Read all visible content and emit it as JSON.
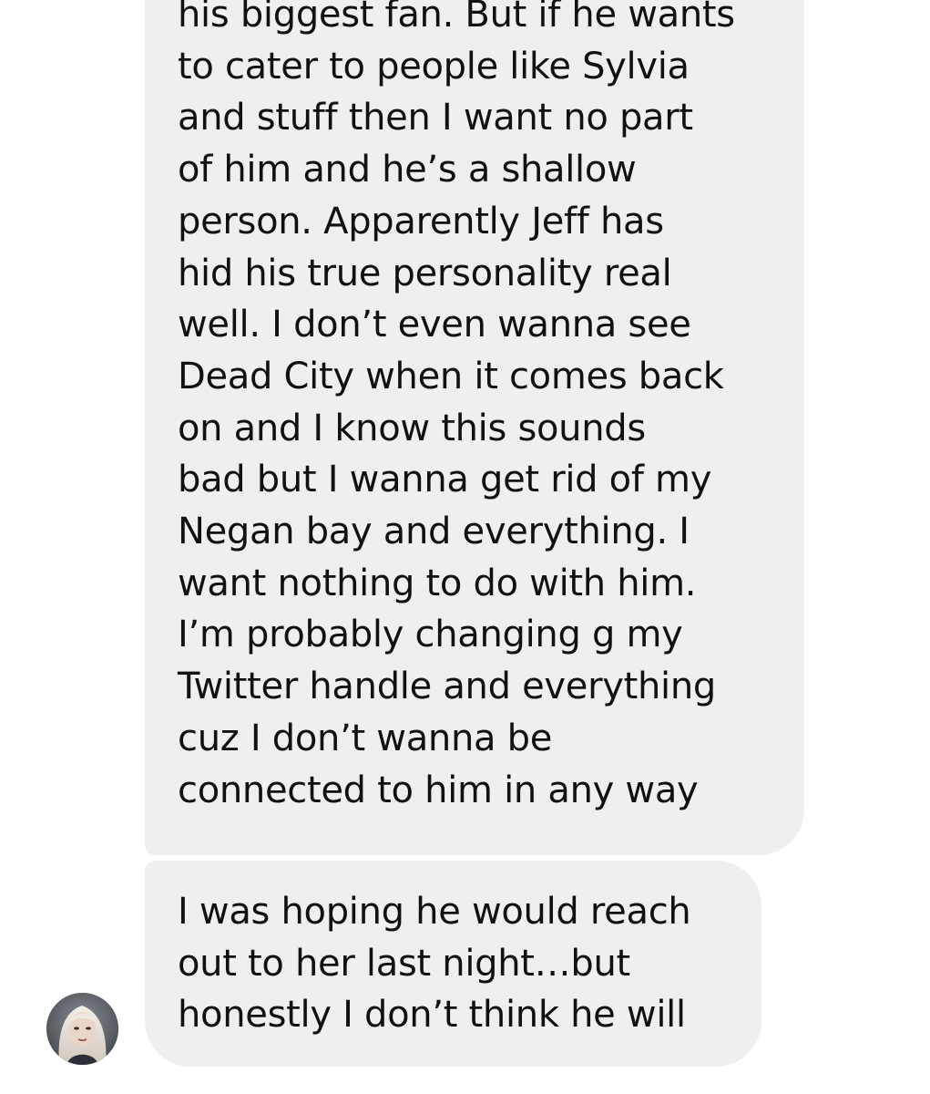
{
  "thread": {
    "messages": [
      {
        "lines": [
          "his biggest fan. But if he wants",
          "to cater to people like Sylvia",
          "and stuff then I want no part",
          "of him and he’s a shallow",
          "person. Apparently Jeff has",
          "hid his true personality real",
          "well. I don’t even wanna see",
          "Dead City when it comes back",
          "on and I know this sounds",
          "bad but I wanna get rid of my",
          "Negan bay and everything. I",
          "want nothing to do with him.",
          "I’m probably changing g my",
          "Twitter handle and everything",
          "cuz I don’t wanna be",
          "connected to him in any way"
        ]
      },
      {
        "lines": [
          "I was hoping he would reach",
          "out to her last night…but",
          "honestly I don’t think he will"
        ]
      }
    ]
  },
  "colors": {
    "bubble_bg": "#efefef",
    "text": "#111111",
    "page_bg": "#ffffff"
  },
  "icons": {
    "avatar": "sender-avatar"
  }
}
